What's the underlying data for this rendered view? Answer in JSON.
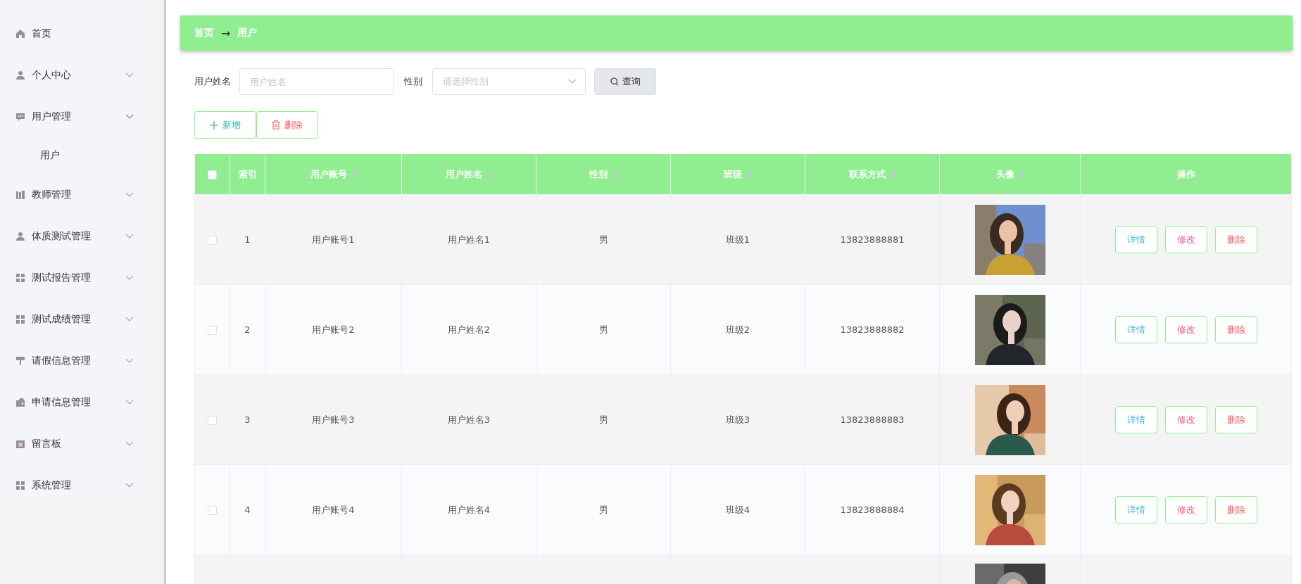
{
  "sidebar": {
    "items": [
      {
        "label": "首页"
      },
      {
        "label": "个人中心",
        "expanded": false
      },
      {
        "label": "用户管理",
        "expanded": true,
        "children": [
          {
            "label": "用户"
          }
        ]
      },
      {
        "label": "教师管理",
        "expanded": false
      },
      {
        "label": "体质测试管理",
        "expanded": false
      },
      {
        "label": "测试报告管理",
        "expanded": false
      },
      {
        "label": "测试成绩管理",
        "expanded": false
      },
      {
        "label": "请假信息管理",
        "expanded": false
      },
      {
        "label": "申请信息管理",
        "expanded": false
      },
      {
        "label": "留言板",
        "expanded": false
      },
      {
        "label": "系统管理",
        "expanded": false
      }
    ]
  },
  "breadcrumb": [
    "首页",
    "→",
    "用户"
  ],
  "filters": {
    "name_label": "用户姓名",
    "name_placeholder": "用户姓名",
    "gender_label": "性别",
    "gender_placeholder": "请选择性别",
    "search_button": "查询"
  },
  "actions": [
    {
      "label": "新增",
      "kind": "add"
    },
    {
      "label": "删除",
      "kind": "delete"
    }
  ],
  "table": {
    "select_all": {
      "checked": false
    },
    "columns": [
      {
        "label": "索引",
        "sortable": false
      },
      {
        "label": "用户账号",
        "sortable": true
      },
      {
        "label": "用户姓名",
        "sortable": true
      },
      {
        "label": "性别",
        "sortable": true
      },
      {
        "label": "班级",
        "sortable": true
      },
      {
        "label": "联系方式",
        "sortable": true
      },
      {
        "label": "头像",
        "sortable": true
      },
      {
        "label": "操作",
        "sortable": false
      }
    ],
    "rows": [
      {
        "selected": false,
        "cells": [
          "1",
          "用户账号1",
          "用户姓名1",
          "男",
          "班级1",
          "13823888881"
        ],
        "avatar": {
          "kind": "picture"
        },
        "buttons": [
          {
            "label": "详情",
            "kind": "detail"
          },
          {
            "label": "修改",
            "kind": "edit"
          },
          {
            "label": "删除",
            "kind": "delete"
          }
        ]
      },
      {
        "selected": false,
        "cells": [
          "2",
          "用户账号2",
          "用户姓名2",
          "男",
          "班级2",
          "13823888882"
        ],
        "avatar": {
          "kind": "picture"
        },
        "buttons": [
          {
            "label": "详情",
            "kind": "detail"
          },
          {
            "label": "修改",
            "kind": "edit"
          },
          {
            "label": "删除",
            "kind": "delete"
          }
        ]
      },
      {
        "selected": false,
        "cells": [
          "3",
          "用户账号3",
          "用户姓名3",
          "男",
          "班级3",
          "13823888883"
        ],
        "avatar": {
          "kind": "picture"
        },
        "buttons": [
          {
            "label": "详情",
            "kind": "detail"
          },
          {
            "label": "修改",
            "kind": "edit"
          },
          {
            "label": "删除",
            "kind": "delete"
          }
        ]
      },
      {
        "selected": false,
        "cells": [
          "4",
          "用户账号4",
          "用户姓名4",
          "男",
          "班级4",
          "13823888884"
        ],
        "avatar": {
          "kind": "picture"
        },
        "buttons": [
          {
            "label": "详情",
            "kind": "detail"
          },
          {
            "label": "修改",
            "kind": "edit"
          },
          {
            "label": "删除",
            "kind": "delete"
          }
        ]
      }
    ],
    "cut_rows": [
      {
        "avatar": {
          "kind": "picture"
        }
      }
    ]
  }
}
